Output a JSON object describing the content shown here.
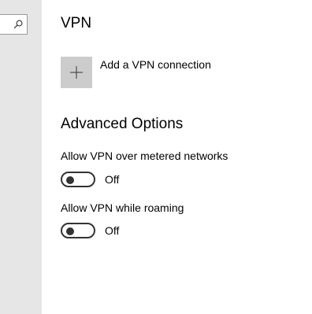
{
  "page": {
    "title": "VPN"
  },
  "add_connection": {
    "label": "Add a VPN connection"
  },
  "advanced_options": {
    "title": "Advanced Options",
    "settings": [
      {
        "label": "Allow VPN over metered networks",
        "state": "Off",
        "on": false
      },
      {
        "label": "Allow VPN while roaming",
        "state": "Off",
        "on": false
      }
    ]
  },
  "colors": {
    "sidebar": "#e6e6e6",
    "tile": "#cccccc",
    "toggle": "#333333"
  },
  "icons": {
    "search": "search-icon",
    "add": "plus-icon"
  }
}
